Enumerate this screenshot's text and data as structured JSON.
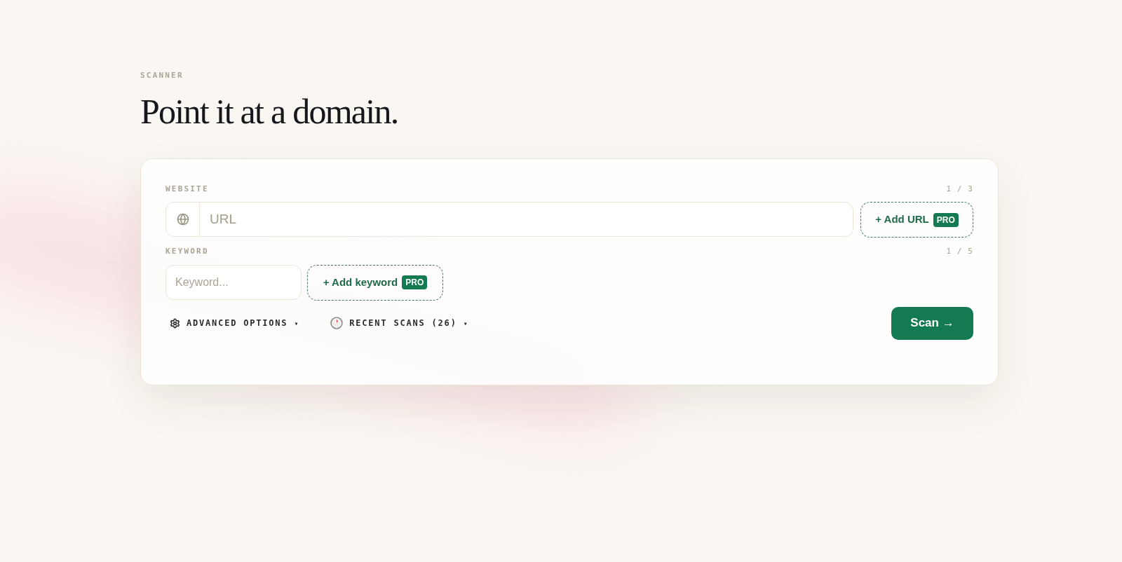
{
  "header": {
    "eyebrow": "SCANNER",
    "title": "Point it at a domain."
  },
  "form": {
    "website": {
      "label": "WEBSITE",
      "count": "1 / 3",
      "placeholder": "URL",
      "add_button": {
        "label": "+ Add URL",
        "badge": "PRO"
      }
    },
    "keyword": {
      "label": "KEYWORD",
      "count": "1 / 5",
      "placeholder": "Keyword...",
      "add_button": {
        "label": "+ Add keyword",
        "badge": "PRO"
      }
    },
    "toggles": [
      {
        "kind": "options",
        "label": "ADVANCED OPTIONS",
        "caret": "▾"
      },
      {
        "kind": "history",
        "label": "RECENT SCANS (26)",
        "caret": "▾"
      }
    ],
    "scan_button": {
      "label": "Scan →"
    }
  }
}
